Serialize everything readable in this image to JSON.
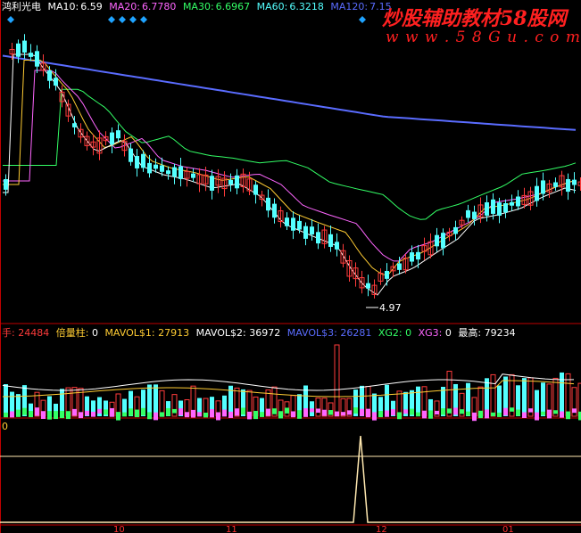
{
  "top_header": {
    "stock_name": "鸿利光电",
    "ma10_label": "MA10:",
    "ma10_value": "6.59",
    "ma20_label": "MA20:",
    "ma20_value": "6.7780",
    "ma30_label": "MA30:",
    "ma30_value": "6.6967",
    "ma60_label": "MA60:",
    "ma60_value": "6.3218",
    "ma120_label": "MA120:",
    "ma120_value": "7.15"
  },
  "volume_header": {
    "unit": "手:",
    "volume_value": "24484",
    "beiliangzhu_label": "倍量柱:",
    "beiliangzhu_value": "0",
    "mavol1_label": "MAVOL$1:",
    "mavol1_value": "27913",
    "mavol2_label": "MAVOL$2:",
    "mavol2_value": "36972",
    "mavol3_label": "MAVOL$3:",
    "mavol3_value": "26281",
    "xg2_label": "XG2:",
    "xg2_value": "0",
    "xg3_label": "XG3:",
    "xg3_value": "0",
    "max_label": "最高:",
    "max_value": "79234"
  },
  "indicator_header": {
    "value": "0"
  },
  "low_marker": {
    "value": "4.97"
  },
  "watermark": {
    "title": "炒股辅助教材58股网",
    "url": "w w w . 5 8 G u . c o m"
  },
  "x_ticks": [
    "10",
    "11",
    "12",
    "01"
  ],
  "colors": {
    "background": "#000000",
    "up_candle": "#ff3b3b",
    "down_candle": "#54ffff",
    "ma10": "#ffffff",
    "ma20": "#ffcc33",
    "ma30": "#ff66ff",
    "ma60": "#33ff66",
    "ma120": "#5a6cff",
    "grid": "#c00000",
    "marker": "#1fa3ff",
    "watermark": "#ff2020"
  },
  "icons": {
    "signal_marker": "diamond-marker-icon"
  }
}
